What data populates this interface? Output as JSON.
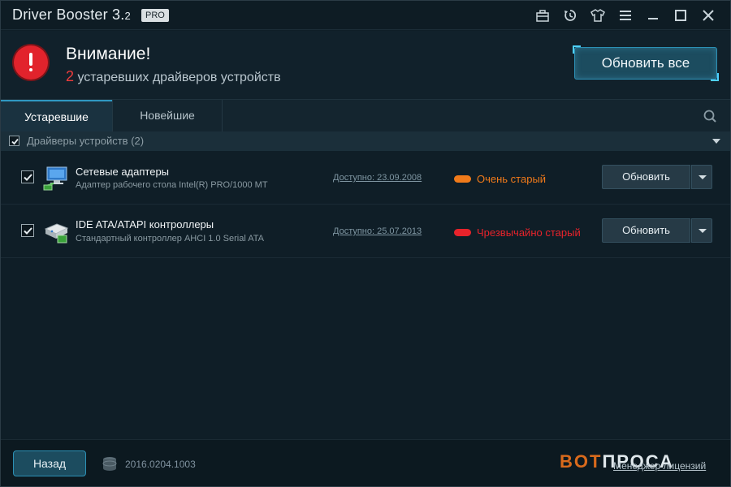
{
  "window": {
    "title": "Driver Booster 3.",
    "version_suffix": "2",
    "badge": "PRO",
    "toolbar_icons": [
      "toolbox-icon",
      "restore-icon",
      "skin-icon",
      "menu-icon",
      "minimize-icon",
      "maximize-icon",
      "close-icon"
    ]
  },
  "alert": {
    "title": "Внимание!",
    "count": "2",
    "subtitle": " устаревших драйверов устройств",
    "update_all_label": "Обновить все"
  },
  "tabs": [
    {
      "label": "Устаревшие",
      "active": true
    },
    {
      "label": "Новейшие",
      "active": false
    }
  ],
  "group": {
    "label": "Драйверы устройств (2)",
    "checked": true
  },
  "drivers": [
    {
      "name": "Сетевые адаптеры",
      "description": "Адаптер рабочего стола Intel(R) PRO/1000 MT",
      "available": "Доступно: 23.09.2008",
      "status": "Очень старый",
      "status_color": "#f07a1a",
      "checked": true,
      "action": "Обновить",
      "icon": "network-adapter-icon"
    },
    {
      "name": "IDE ATA/ATAPI контроллеры",
      "description": "Стандартный контроллер AHCI 1.0 Serial ATA",
      "available": "Доступно: 25.07.2013",
      "status": "Чрезвычайно старый",
      "status_color": "#e8232b",
      "checked": true,
      "action": "Обновить",
      "icon": "ide-controller-icon"
    }
  ],
  "footer": {
    "back_label": "Назад",
    "version": "2016.0204.1003",
    "license_link": "Менеджер лицензий",
    "watermark_prefix": "BOT",
    "watermark_rest": "ПРОСА"
  },
  "colors": {
    "accent": "#2c90b5",
    "alert_red": "#e2232c",
    "background": "#0f1e27"
  }
}
